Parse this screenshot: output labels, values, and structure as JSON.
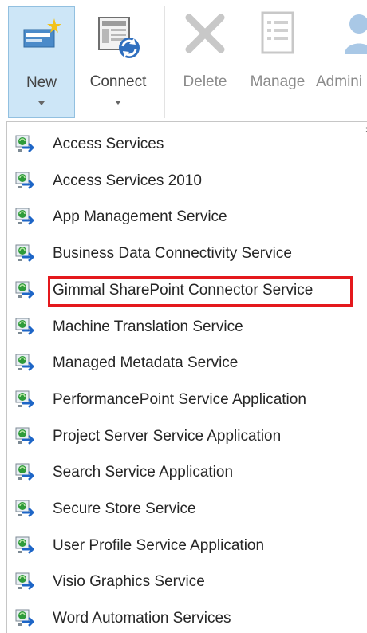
{
  "ribbon": {
    "new_label": "New",
    "connect_label": "Connect",
    "delete_label": "Delete",
    "manage_label": "Manage",
    "admin_label": "Admini"
  },
  "menu": {
    "items": [
      {
        "label": "Access Services",
        "icon": "service-app-icon"
      },
      {
        "label": "Access Services 2010",
        "icon": "service-app-icon"
      },
      {
        "label": "App Management Service",
        "icon": "service-app-icon"
      },
      {
        "label": "Business Data Connectivity Service",
        "icon": "service-app-icon"
      },
      {
        "label": "Gimmal SharePoint Connector Service",
        "icon": "service-app-icon",
        "highlighted": true
      },
      {
        "label": "Machine Translation Service",
        "icon": "service-app-icon"
      },
      {
        "label": "Managed Metadata Service",
        "icon": "service-app-icon"
      },
      {
        "label": "PerformancePoint Service Application",
        "icon": "service-app-icon"
      },
      {
        "label": "Project Server Service Application",
        "icon": "service-app-icon"
      },
      {
        "label": "Search Service Application",
        "icon": "service-app-icon"
      },
      {
        "label": "Secure Store Service",
        "icon": "service-app-icon"
      },
      {
        "label": "User Profile Service Application",
        "icon": "service-app-icon"
      },
      {
        "label": "Visio Graphics Service",
        "icon": "service-app-icon"
      },
      {
        "label": "Word Automation Services",
        "icon": "service-app-icon"
      }
    ]
  },
  "colors": {
    "highlight_border": "#e4181c",
    "selected_button_bg": "#cde6f7",
    "selected_button_border": "#92c0e0"
  }
}
